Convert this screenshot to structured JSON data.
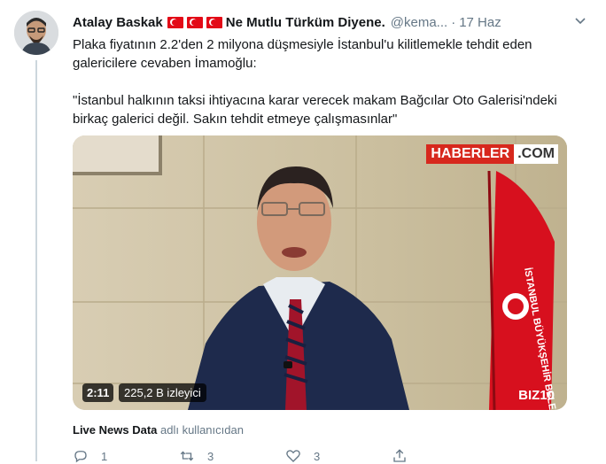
{
  "tweet": {
    "author_name": "Atalay Baskak",
    "retweeter_text": "Ne Mutlu Türküm Diyene.",
    "handle": "@kema...",
    "separator": "·",
    "time": "17 Haz",
    "line1": "Plaka fiyatının 2.2'den 2 milyona düşmesiyle İstanbul'u kilitlemekle tehdit eden galericilere cevaben İmamoğlu:",
    "quote": "\"İstanbul halkının taksi ihtiyacına karar verecek makam Bağcılar Oto Galerisi'ndeki birkaç galerici değil. Sakın tehdit etmeye çalışmasınlar\""
  },
  "media": {
    "duration": "2:11",
    "views": "225,2 B izleyici",
    "logo_left": "HABERLER",
    "logo_right": ".COM",
    "corner_logo": "BIZ10",
    "flag_text": "İSTANBUL BÜYÜKŞEHİR BELEDİYESİ"
  },
  "source": {
    "name": "Live News Data",
    "suffix": "adlı kullanıcıdan"
  },
  "actions": {
    "reply_count": "1",
    "retweet_count": "3",
    "like_count": "3"
  },
  "colors": {
    "accent": "#1da1f2",
    "muted": "#657786",
    "flag_red": "#e30a17"
  }
}
